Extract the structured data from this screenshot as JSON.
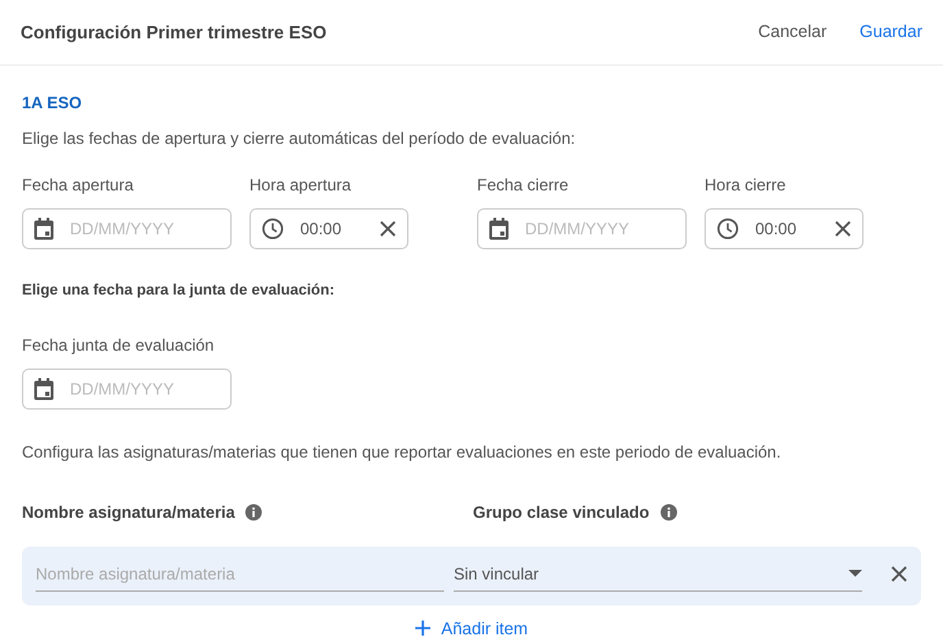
{
  "header": {
    "title": "Configuración Primer trimestre ESO",
    "buttons": [
      {
        "label": "Cancelar",
        "kind": "cancel"
      },
      {
        "label": "Guardar",
        "kind": "save"
      }
    ]
  },
  "group": {
    "name": "1A ESO",
    "instruction": "Elige las fechas de apertura y cierre automáticas del período de evaluación:",
    "fields": [
      {
        "kind": "date",
        "label": "Fecha apertura",
        "placeholder": "DD/MM/YYYY"
      },
      {
        "kind": "time",
        "label": "Hora apertura",
        "value": "00:00"
      },
      {
        "kind": "date",
        "label": "Fecha cierre",
        "placeholder": "DD/MM/YYYY"
      },
      {
        "kind": "time",
        "label": "Hora cierre",
        "value": "00:00"
      }
    ]
  },
  "meeting": {
    "heading": "Elige una fecha para la junta de evaluación:",
    "field": {
      "kind": "date",
      "label": "Fecha junta de evaluación",
      "placeholder": "DD/MM/YYYY"
    }
  },
  "subjects": {
    "description": "Configura las asignaturas/materias que tienen que reportar evaluaciones en este periodo de evaluación.",
    "columns": [
      {
        "label": "Nombre asignatura/materia"
      },
      {
        "label": "Grupo clase vinculado"
      }
    ],
    "rows": [
      {
        "name_placeholder": "Nombre asignatura/materia",
        "group": "Sin vincular"
      }
    ],
    "add_button": "Añadir item"
  }
}
